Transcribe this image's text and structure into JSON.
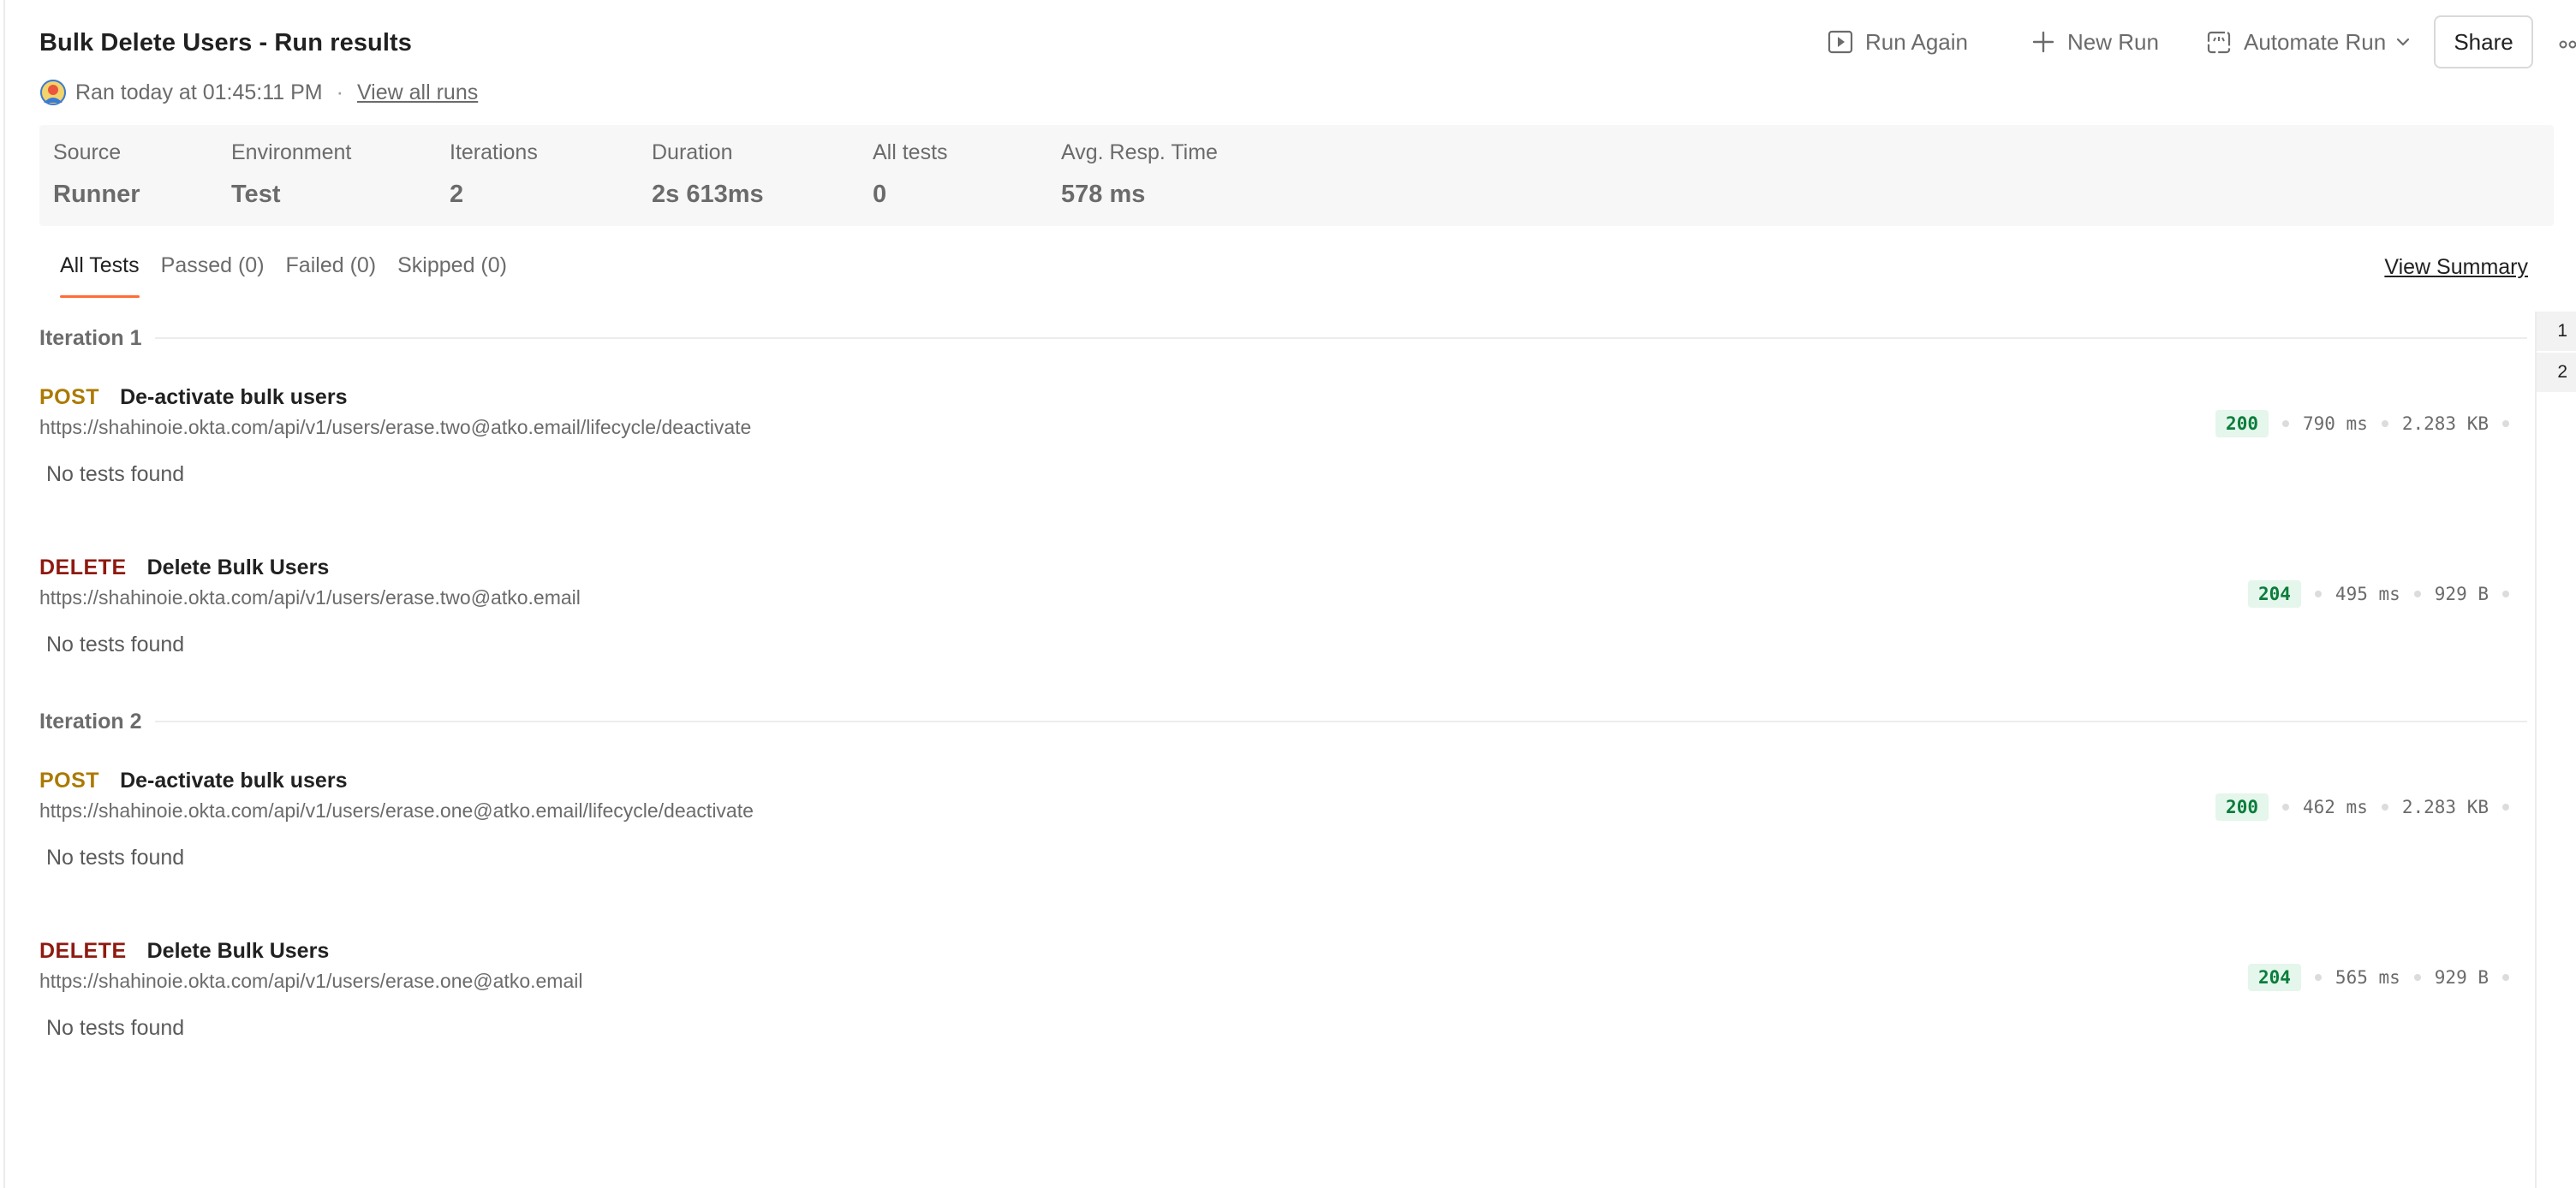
{
  "header": {
    "title": "Bulk Delete Users - Run results",
    "run_again_label": "Run Again",
    "new_run_label": "New Run",
    "automate_run_label": "Automate Run",
    "share_label": "Share",
    "ran_text": "Ran today at 01:45:11 PM",
    "separator": "·",
    "view_all_runs_label": "View all runs"
  },
  "summary": [
    {
      "label": "Source",
      "value": "Runner"
    },
    {
      "label": "Environment",
      "value": "Test"
    },
    {
      "label": "Iterations",
      "value": "2"
    },
    {
      "label": "Duration",
      "value": "2s 613ms"
    },
    {
      "label": "All tests",
      "value": "0"
    },
    {
      "label": "Avg. Resp. Time",
      "value": "578 ms"
    }
  ],
  "tabs": [
    {
      "label": "All Tests",
      "active": true
    },
    {
      "label": "Passed (0)",
      "active": false
    },
    {
      "label": "Failed (0)",
      "active": false
    },
    {
      "label": "Skipped (0)",
      "active": false
    }
  ],
  "view_summary_label": "View Summary",
  "iterations": [
    {
      "label": "Iteration 1",
      "requests": [
        {
          "method": "POST",
          "name": "De-activate bulk users",
          "url": "https://shahinoie.okta.com/api/v1/users/erase.two@atko.email/lifecycle/deactivate",
          "status": "200",
          "time": "790 ms",
          "size": "2.283 KB",
          "tests": "No tests found"
        },
        {
          "method": "DELETE",
          "name": "Delete Bulk Users",
          "url": "https://shahinoie.okta.com/api/v1/users/erase.two@atko.email",
          "status": "204",
          "time": "495 ms",
          "size": "929 B",
          "tests": "No tests found"
        }
      ]
    },
    {
      "label": "Iteration 2",
      "requests": [
        {
          "method": "POST",
          "name": "De-activate bulk users",
          "url": "https://shahinoie.okta.com/api/v1/users/erase.one@atko.email/lifecycle/deactivate",
          "status": "200",
          "time": "462 ms",
          "size": "2.283 KB",
          "tests": "No tests found"
        },
        {
          "method": "DELETE",
          "name": "Delete Bulk Users",
          "url": "https://shahinoie.okta.com/api/v1/users/erase.one@atko.email",
          "status": "204",
          "time": "565 ms",
          "size": "929 B",
          "tests": "No tests found"
        }
      ]
    }
  ],
  "side_nav": [
    "1",
    "2"
  ],
  "colors": {
    "accent": "#ff6c37",
    "post": "#ab7a00",
    "delete": "#8e1a10",
    "success_bg": "#e5f6ec",
    "success_text": "#0a7d3b"
  }
}
